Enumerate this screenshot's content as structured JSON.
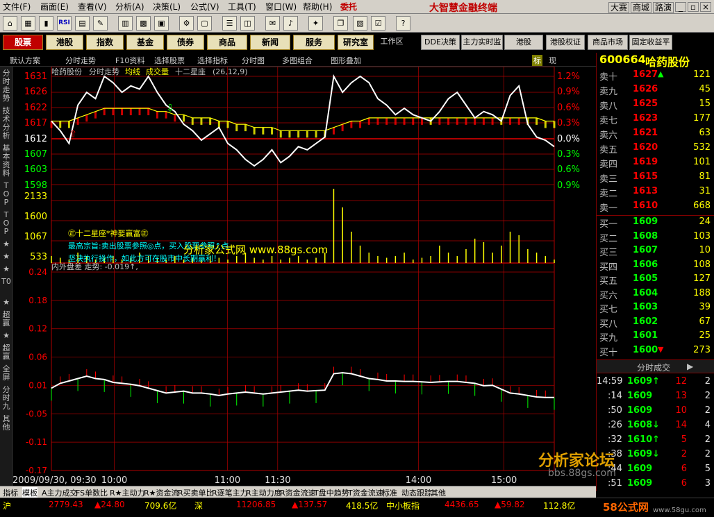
{
  "menu": [
    "文件(F)",
    "画面(E)",
    "查看(V)",
    "分析(A)",
    "决策(L)",
    "公式(V)",
    "工具(T)",
    "窗口(W)",
    "帮助(H)"
  ],
  "weituo": "委托",
  "app_title": "大智慧金融终端",
  "top_right": [
    "大赛",
    "商城",
    "路演"
  ],
  "nav": [
    "股票",
    "港股",
    "指数",
    "基金",
    "债券",
    "商品",
    "新闻",
    "服务",
    "研究室"
  ],
  "nav2": [
    "工作区",
    "DDE决策",
    "主力实时监",
    "港股",
    "港股权证",
    "商品市场",
    "固定收益平"
  ],
  "sub": [
    "默认方案",
    "分时走势",
    "F10资料",
    "选择股票",
    "选择指标",
    "分时图",
    "多图组合",
    "图形叠加"
  ],
  "sub_right": [
    "标",
    "现"
  ],
  "stock": {
    "code": "600664",
    "name": "哈药股份"
  },
  "chart_header": [
    "哈药股份",
    "分时走势",
    "均线",
    "成交量",
    "十二星座",
    "(26,12,9)"
  ],
  "price_ticks": [
    "1631",
    "1626",
    "1622",
    "1617",
    "1612",
    "1607",
    "1603",
    "1598"
  ],
  "pct_ticks": [
    "1.2%",
    "0.9%",
    "0.6%",
    "0.3%",
    "0.0%",
    "0.3%",
    "0.6%",
    "0.9%"
  ],
  "vol_ticks": [
    "2133",
    "1600",
    "1067",
    "533"
  ],
  "indicator_header": "内外盘差  走势: -0.019↑,",
  "ind_ticks": [
    "0.24",
    "0.18",
    "0.12",
    "0.06",
    "0.01",
    "-0.05",
    "-0.11",
    "-0.17"
  ],
  "time_labels": [
    "2009/09/30, 09:30",
    "10:00",
    "11:00",
    "11:30",
    "14:00",
    "15:00"
  ],
  "watermark": "分析家公式网 www.88gs.com",
  "overlay_lines": [
    "㊣十二星座*神娶赢富㊣",
    "最高宗旨:卖出股票参照◎点，买入股票参照↑点",
    "坚决执行操作，如此方可在股市中长期赢利！"
  ],
  "sell": [
    {
      "label": "卖十",
      "price": "1627",
      "vol": "121",
      "mark": "▲"
    },
    {
      "label": "卖九",
      "price": "1626",
      "vol": "45"
    },
    {
      "label": "卖八",
      "price": "1625",
      "vol": "15"
    },
    {
      "label": "卖七",
      "price": "1623",
      "vol": "177"
    },
    {
      "label": "卖六",
      "price": "1621",
      "vol": "63"
    },
    {
      "label": "卖五",
      "price": "1620",
      "vol": "532"
    },
    {
      "label": "卖四",
      "price": "1619",
      "vol": "101"
    },
    {
      "label": "卖三",
      "price": "1615",
      "vol": "81"
    },
    {
      "label": "卖二",
      "price": "1613",
      "vol": "31"
    },
    {
      "label": "卖一",
      "price": "1610",
      "vol": "668"
    }
  ],
  "buy": [
    {
      "label": "买一",
      "price": "1609",
      "vol": "24"
    },
    {
      "label": "买二",
      "price": "1608",
      "vol": "103"
    },
    {
      "label": "买三",
      "price": "1607",
      "vol": "10"
    },
    {
      "label": "买四",
      "price": "1606",
      "vol": "108"
    },
    {
      "label": "买五",
      "price": "1605",
      "vol": "127"
    },
    {
      "label": "买六",
      "price": "1604",
      "vol": "188"
    },
    {
      "label": "买七",
      "price": "1603",
      "vol": "39"
    },
    {
      "label": "买八",
      "price": "1602",
      "vol": "67"
    },
    {
      "label": "买九",
      "price": "1601",
      "vol": "25"
    },
    {
      "label": "买十",
      "price": "1600",
      "vol": "273",
      "mark": "▼"
    }
  ],
  "trades_header": "分时成交",
  "trades": [
    {
      "time": "14:59",
      "price": "1609↑",
      "vol": "12",
      "n": "2"
    },
    {
      "time": ":14",
      "price": "1609",
      "vol": "13",
      "n": "2"
    },
    {
      "time": ":50",
      "price": "1609",
      "vol": "10",
      "n": "2"
    },
    {
      "time": ":26",
      "price": "1608↓",
      "vol": "14",
      "n": "4"
    },
    {
      "time": ":32",
      "price": "1610↑",
      "vol": "5",
      "n": "2"
    },
    {
      "time": ":38",
      "price": "1609↓",
      "vol": "2",
      "n": "2"
    },
    {
      "time": ":44",
      "price": "1609",
      "vol": "6",
      "n": "5"
    },
    {
      "time": ":51",
      "price": "1609",
      "vol": "6",
      "n": "3"
    }
  ],
  "bottom_tabs": [
    "指标",
    "模板",
    "A主力成交",
    "FS单数比",
    "R★主动力",
    "R★资金流",
    "R买卖单比",
    "R逐笔主力",
    "R主动力度",
    "R资金流速",
    "T盘中趋势",
    "T资金流速",
    "标准",
    "动态跟踪",
    "其他"
  ],
  "ticker": [
    "沪",
    "2779.43",
    "▲24.80",
    "709.6亿",
    "深",
    "11206.85",
    "▲137.57",
    "418.5亿",
    "中小板指",
    "4436.65",
    "▲59.82",
    "112.8亿"
  ],
  "logo2": "分析家论坛",
  "logo2_url": "bbs.88gs.com",
  "logo3": "58公式网",
  "logo3_url": "www.58gu.com",
  "sidebar": [
    "分时走势",
    "技术分析",
    "基本资料",
    "TOP",
    "TOP",
    "★",
    "★",
    "★",
    "T0",
    "★",
    "超赢",
    "★",
    "超赢",
    "全屏",
    "分时九",
    "其他"
  ],
  "colors": {
    "up": "#ff0000",
    "down": "#00ff00",
    "price": "#ffffff",
    "avg": "#ffff00",
    "grid": "#b00000"
  },
  "chart_data": {
    "type": "line",
    "price_series": [
      1617,
      1614,
      1610,
      1622,
      1626,
      1624,
      1631,
      1629,
      1626,
      1628,
      1627,
      1631,
      1626,
      1622,
      1620,
      1616,
      1614,
      1611,
      1613,
      1615,
      1610,
      1608,
      1605,
      1603,
      1605,
      1608,
      1604,
      1606,
      1609,
      1608,
      1610,
      1612,
      1631,
      1626,
      1629,
      1631,
      1629,
      1624,
      1622,
      1619,
      1621,
      1619,
      1618,
      1617,
      1620,
      1624,
      1626,
      1622,
      1618,
      1620,
      1619,
      1617,
      1625,
      1628,
      1616,
      1612,
      1611,
      1609
    ],
    "avg_series": [
      1617,
      1617,
      1617,
      1618,
      1619,
      1620,
      1621,
      1621,
      1621,
      1621,
      1621,
      1621,
      1620,
      1620,
      1619,
      1619,
      1618,
      1618,
      1618,
      1617,
      1617,
      1616,
      1616,
      1615,
      1615,
      1615,
      1614,
      1614,
      1614,
      1614,
      1614,
      1614,
      1615,
      1616,
      1617,
      1617,
      1618,
      1618,
      1618,
      1618,
      1618,
      1618,
      1618,
      1618,
      1618,
      1618,
      1618,
      1618,
      1618,
      1618,
      1618,
      1618,
      1618,
      1618,
      1618,
      1618,
      1617,
      1617
    ],
    "ind_series": [
      0.0,
      0.01,
      0.015,
      0.02,
      0.025,
      0.02,
      0.018,
      0.012,
      0.01,
      0.008,
      0.005,
      0.0,
      -0.005,
      -0.01,
      -0.008,
      -0.006,
      -0.01,
      -0.01,
      -0.012,
      -0.015,
      -0.012,
      -0.01,
      -0.008,
      -0.01,
      -0.012,
      -0.01,
      -0.008,
      -0.006,
      -0.004,
      -0.006,
      -0.005,
      -0.004,
      0.03,
      0.032,
      0.03,
      0.025,
      0.02,
      0.018,
      0.015,
      0.015,
      0.014,
      0.014,
      0.013,
      0.012,
      0.013,
      0.014,
      0.014,
      0.012,
      0.01,
      0.005,
      0.006,
      -0.002,
      -0.01,
      -0.012,
      -0.015,
      -0.018,
      -0.019,
      -0.019
    ],
    "vol_series": [
      200,
      150,
      100,
      300,
      200,
      100,
      150,
      200,
      100,
      150,
      300,
      200,
      150,
      100,
      200,
      100,
      150,
      100,
      200,
      150,
      100,
      200,
      300,
      150,
      100,
      200,
      100,
      150,
      200,
      100,
      150,
      300,
      2133,
      1600,
      900,
      500,
      300,
      200,
      150,
      200,
      300,
      100,
      150,
      200,
      500,
      300,
      200,
      400,
      700,
      600,
      300,
      500,
      900,
      800,
      400,
      300,
      200,
      100
    ],
    "ylim_price": [
      1598,
      1631
    ],
    "ylim_ind": [
      -0.17,
      0.24
    ],
    "ylim_vol": [
      0,
      2133
    ]
  }
}
